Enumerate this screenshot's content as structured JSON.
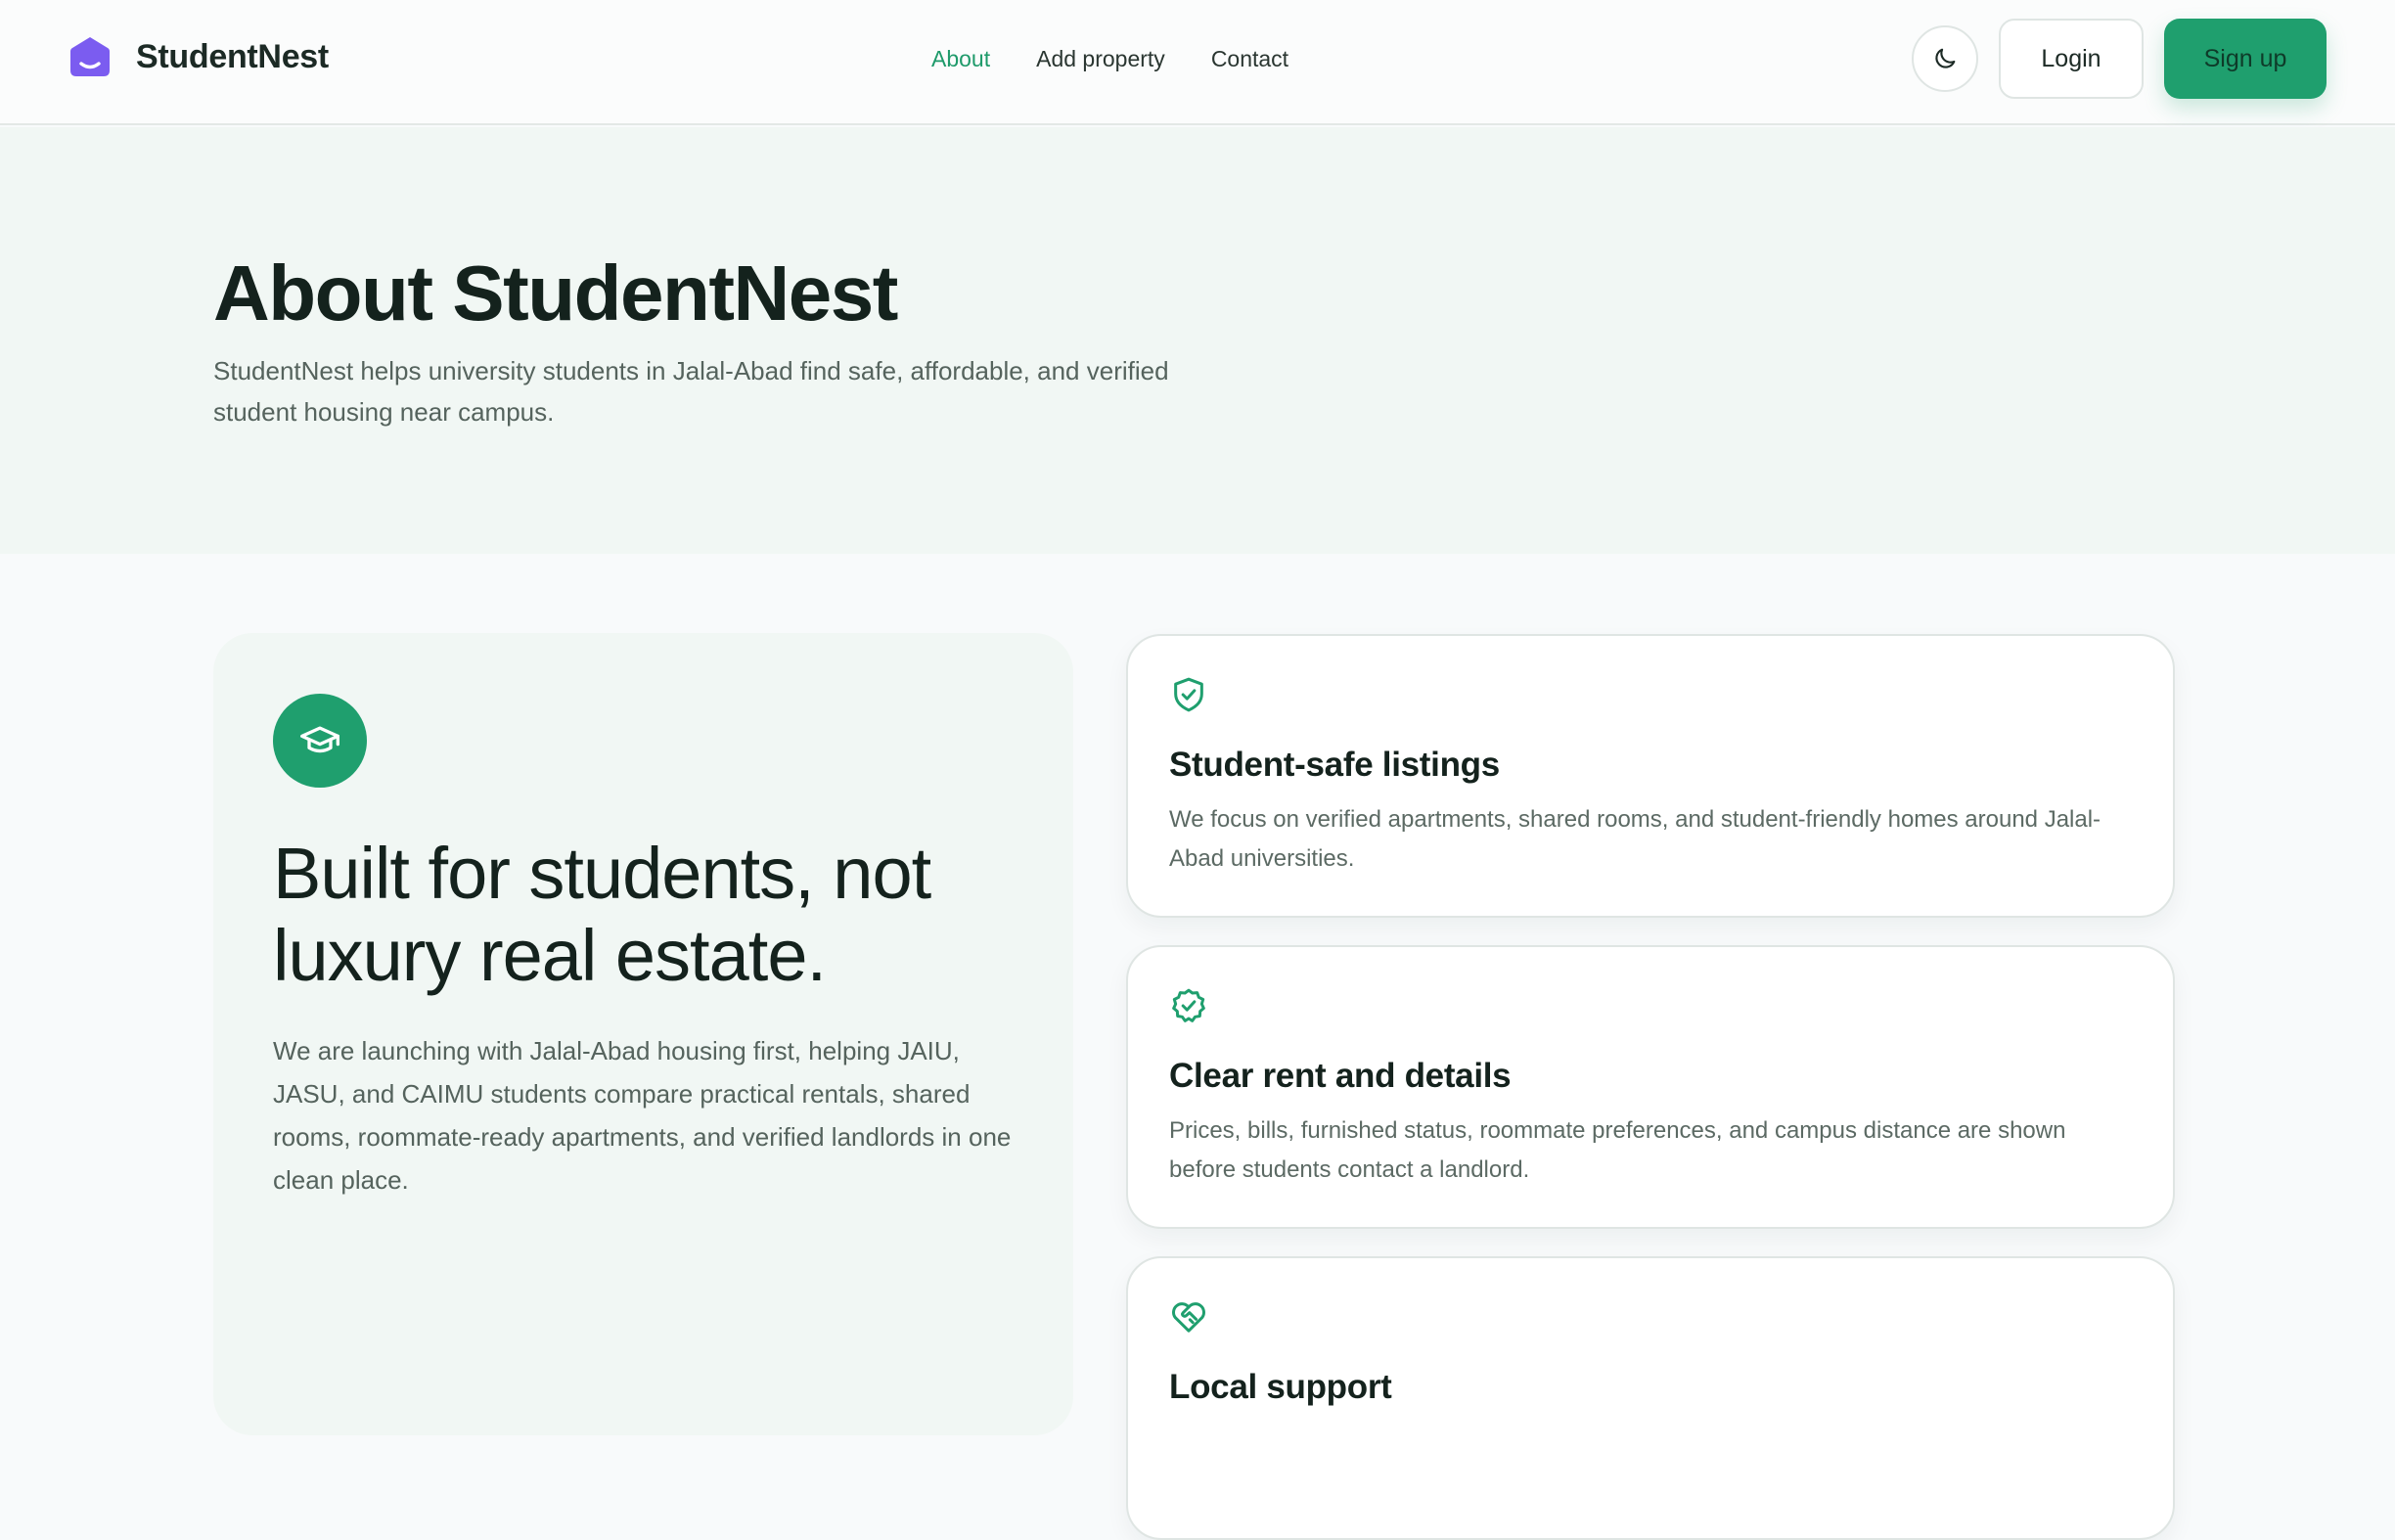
{
  "header": {
    "brand_name": "StudentNest",
    "brand_logo_icon": "house-smile-icon",
    "nav": [
      {
        "label": "About",
        "active": true
      },
      {
        "label": "Add property",
        "active": false
      },
      {
        "label": "Contact",
        "active": false
      }
    ],
    "theme_toggle_icon": "moon-icon",
    "login_label": "Login",
    "signup_label": "Sign up"
  },
  "hero": {
    "title": "About StudentNest",
    "subtitle_line1": "StudentNest helps university students in Jalal-Abad find safe, affordable, and verified",
    "subtitle_line2": "student housing near campus."
  },
  "feature": {
    "icon": "graduation-cap-icon",
    "title_line1": "Built for students, not",
    "title_line2": "luxury real estate.",
    "text": "We are launching with Jalal-Abad housing first, helping JAIU, JASU, and CAIMU students compare practical rentals, shared rooms, roommate-ready apartments, and verified landlords in one clean place."
  },
  "cards": [
    {
      "icon": "shield-check-icon",
      "title": "Student-safe listings",
      "text": "We focus on verified apartments, shared rooms, and student-friendly homes around Jalal-Abad universities."
    },
    {
      "icon": "badge-check-icon",
      "title": "Clear rent and details",
      "text": "Prices, bills, furnished status, roommate preferences, and campus distance are shown before students contact a landlord."
    },
    {
      "icon": "heart-handshake-icon",
      "title": "Local support",
      "text": ""
    }
  ],
  "colors": {
    "accent": "#1f9f6e",
    "brand_logo": "#7b5cf0",
    "hero_bg": "#f1f7f4",
    "page_bg": "#f8fafb"
  }
}
